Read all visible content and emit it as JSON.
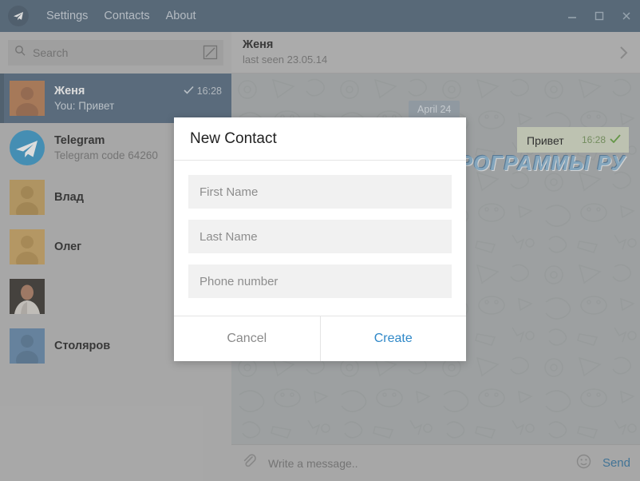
{
  "titlebar": {
    "logo_icon": "telegram-plane-icon",
    "menu": [
      {
        "label": "Settings"
      },
      {
        "label": "Contacts"
      },
      {
        "label": "About"
      }
    ],
    "window_controls": [
      {
        "name": "minimize",
        "icon": "minimize-icon"
      },
      {
        "name": "maximize",
        "icon": "maximize-icon"
      },
      {
        "name": "close",
        "icon": "close-icon"
      }
    ]
  },
  "sidebar": {
    "search": {
      "placeholder": "Search",
      "search_icon": "search-icon",
      "compose_icon": "compose-icon"
    },
    "chats": [
      {
        "name": "Женя",
        "message": "You: Привет",
        "time": "16:28",
        "status_icon": "check-icon",
        "avatar": "person-placeholder",
        "avatar_color": "#b5764a",
        "selected": true
      },
      {
        "name": "Telegram",
        "message": "Telegram code 64260",
        "time": "",
        "avatar": "telegram-logo",
        "avatar_color": "#2f94c6",
        "selected": false
      },
      {
        "name": "Влад",
        "message": "",
        "time": "",
        "avatar": "person-placeholder",
        "avatar_color": "#c19b56",
        "selected": false
      },
      {
        "name": "Олег",
        "message": "",
        "time": "",
        "avatar": "person-placeholder",
        "avatar_color": "#c8a059",
        "selected": false
      },
      {
        "name": "",
        "message": "",
        "time": "",
        "avatar": "user-photo",
        "avatar_color": "#3f3a33",
        "selected": false
      },
      {
        "name": "Столяров",
        "message": "",
        "time": "",
        "avatar": "person-placeholder",
        "avatar_color": "#5c83a8",
        "selected": false
      }
    ]
  },
  "chat": {
    "header": {
      "name": "Женя",
      "status": "last seen 23.05.14",
      "chevron_icon": "chevron-right-icon"
    },
    "date_badge": "April 24",
    "messages": [
      {
        "text": "Привет",
        "time": "16:28",
        "status_icon": "check-icon",
        "outgoing": true
      }
    ],
    "watermark": "ТВОИ ПРОГРАММЫ РУ",
    "composer": {
      "attach_icon": "paperclip-icon",
      "placeholder": "Write a message..",
      "emoji_icon": "smiley-icon",
      "send_label": "Send"
    }
  },
  "modal": {
    "title": "New Contact",
    "fields": [
      {
        "name": "first-name",
        "placeholder": "First Name",
        "value": ""
      },
      {
        "name": "last-name",
        "placeholder": "Last Name",
        "value": ""
      },
      {
        "name": "phone-number",
        "placeholder": "Phone number",
        "value": ""
      }
    ],
    "cancel_label": "Cancel",
    "create_label": "Create"
  },
  "colors": {
    "titlebar": "#496075",
    "selected_row": "#4b637a",
    "accent_blue": "#2f88c8",
    "send_blue": "#2a6f9e",
    "bubble_green": "#d4dcc4",
    "check_green": "#5a9e33"
  }
}
